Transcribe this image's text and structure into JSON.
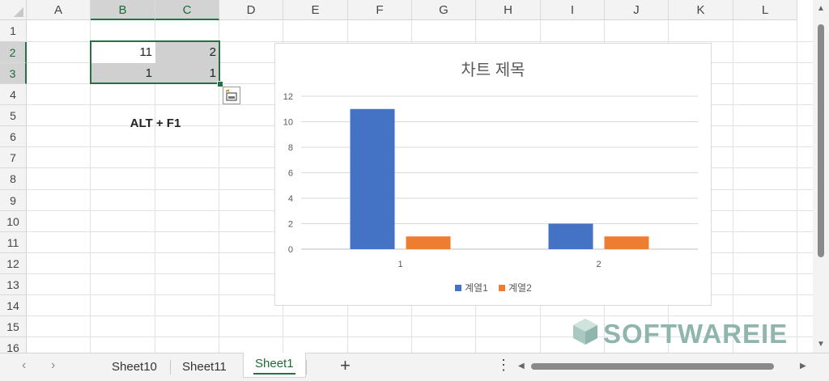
{
  "columns": [
    "A",
    "B",
    "C",
    "D",
    "E",
    "F",
    "G",
    "H",
    "I",
    "J",
    "K",
    "L"
  ],
  "rows": [
    "1",
    "2",
    "3",
    "4",
    "5",
    "6",
    "7",
    "8",
    "9",
    "10",
    "11",
    "12",
    "13",
    "14",
    "15",
    "16"
  ],
  "cells": {
    "B2": "11",
    "C2": "2",
    "B3": "1",
    "C3": "1",
    "B5": "ALT + F1"
  },
  "chart": {
    "title": "차트 제목",
    "legend": [
      "계열1",
      "계열2"
    ]
  },
  "chart_data": {
    "type": "bar",
    "title": "차트 제목",
    "categories": [
      "1",
      "2"
    ],
    "series": [
      {
        "name": "계열1",
        "values": [
          11,
          2
        ],
        "color": "#4472C4"
      },
      {
        "name": "계열2",
        "values": [
          1,
          1
        ],
        "color": "#ED7D31"
      }
    ],
    "ylim": [
      0,
      12
    ],
    "yticks": [
      0,
      2,
      4,
      6,
      8,
      10,
      12
    ],
    "grid": true,
    "legend_position": "bottom"
  },
  "sheets": [
    "Sheet10",
    "Sheet11",
    "Sheet1"
  ],
  "active_sheet": "Sheet1",
  "watermark": "SOFTWAREIE",
  "colors": {
    "excel_green": "#217346",
    "selected_fill": "#d0d0d0"
  }
}
